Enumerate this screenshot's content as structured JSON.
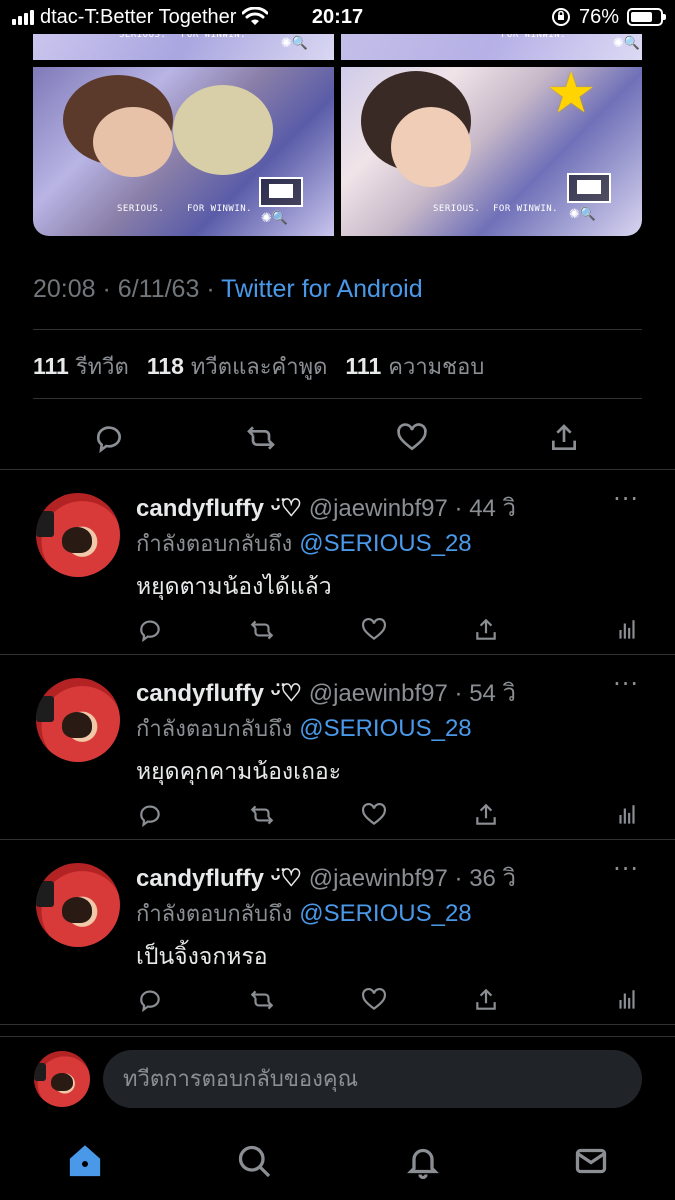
{
  "status_bar": {
    "carrier": "dtac-T:Better Together",
    "time": "20:17",
    "battery": "76%",
    "battery_level": 0.76
  },
  "media": {
    "tiles": [
      {
        "caption": "SERIOUS.",
        "caption2": "FOR WINWIN."
      },
      {
        "caption": "FOR WINWIN."
      },
      {
        "caption": "SERIOUS.",
        "caption2": "FOR WINWIN."
      },
      {
        "caption": "SERIOUS.",
        "caption2": "FOR WINWIN."
      }
    ]
  },
  "tweet_meta": {
    "time": "20:08",
    "separator": "·",
    "date": "6/11/63",
    "source": "Twitter for Android"
  },
  "stats": {
    "retweets_count": "111",
    "retweets_label": "รีทวีต",
    "quotes_count": "118",
    "quotes_label": "ทวีตและคำพูด",
    "likes_count": "111",
    "likes_label": "ความชอบ"
  },
  "action_icons": [
    "reply-icon",
    "retweet-icon",
    "like-icon",
    "share-icon"
  ],
  "replies": [
    {
      "name": "candyfluffy ᵕ̈♡",
      "handle": "@jaewinbf97",
      "time": "· 44 วิ",
      "replying_label": "กำลังตอบกลับถึง",
      "mention": "@SERIOUS_28",
      "text": "หยุดตามน้องได้แล้ว",
      "more": "···"
    },
    {
      "name": "candyfluffy ᵕ̈♡",
      "handle": "@jaewinbf97",
      "time": "· 54 วิ",
      "replying_label": "กำลังตอบกลับถึง",
      "mention": "@SERIOUS_28",
      "text": "หยุดคุกคามน้องเถอะ",
      "more": "···"
    },
    {
      "name": "candyfluffy ᵕ̈♡",
      "handle": "@jaewinbf97",
      "time": "· 36 วิ",
      "replying_label": "กำลังตอบกลับถึง",
      "mention": "@SERIOUS_28",
      "text": "เป็นจิ้งจกหรอ",
      "more": "···"
    }
  ],
  "compose": {
    "placeholder": "ทวีตการตอบกลับของคุณ"
  },
  "tabs": [
    "home-icon",
    "search-icon",
    "notifications-icon",
    "messages-icon"
  ],
  "colors": {
    "accent": "#4a99e9",
    "background": "#000000",
    "muted": "#8b8f94",
    "divider": "#2f3336"
  }
}
